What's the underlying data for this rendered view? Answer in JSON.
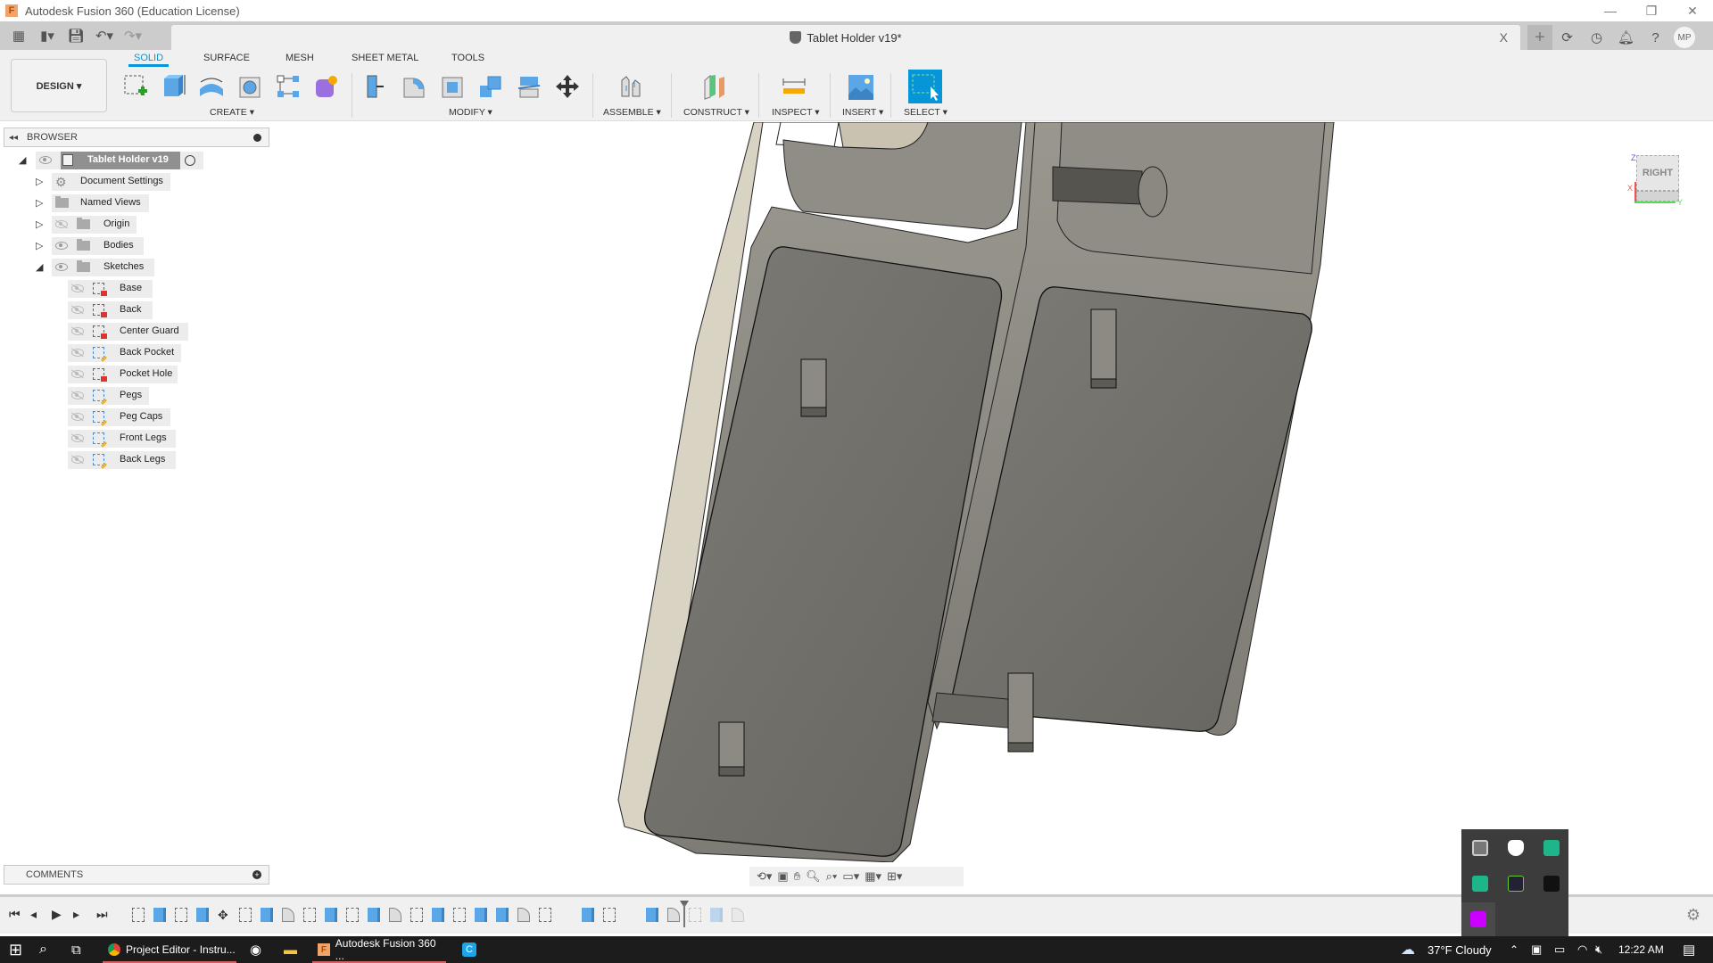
{
  "window": {
    "title": "Autodesk Fusion 360 (Education License)",
    "controls": [
      "minimize",
      "restore",
      "close"
    ]
  },
  "quick_access": {
    "icons": [
      "app-grid-icon",
      "file-icon",
      "save-icon",
      "undo-icon",
      "redo-icon"
    ]
  },
  "document_tab": {
    "name": "Tablet Holder v19*",
    "close_label": "X"
  },
  "header_right": {
    "new_tab_label": "+",
    "icons": [
      "extensions-icon",
      "job-status-icon",
      "notifications-icon",
      "help-icon"
    ],
    "user_initials": "MP"
  },
  "ribbon": {
    "workspace_label": "DESIGN ▾",
    "tabs": [
      {
        "label": "SOLID",
        "active": true
      },
      {
        "label": "SURFACE",
        "active": false
      },
      {
        "label": "MESH",
        "active": false
      },
      {
        "label": "SHEET METAL",
        "active": false
      },
      {
        "label": "TOOLS",
        "active": false
      }
    ],
    "groups": {
      "create": "CREATE ▾",
      "modify": "MODIFY ▾",
      "assemble": "ASSEMBLE ▾",
      "construct": "CONSTRUCT ▾",
      "inspect": "INSPECT ▾",
      "insert": "INSERT ▾",
      "select": "SELECT ▾"
    }
  },
  "browser": {
    "header": "BROWSER",
    "root": "Tablet Holder v19",
    "nodes": [
      {
        "label": "Document Settings"
      },
      {
        "label": "Named Views"
      },
      {
        "label": "Origin"
      },
      {
        "label": "Bodies"
      },
      {
        "label": "Sketches"
      }
    ],
    "sketches": [
      {
        "label": "Base",
        "state": "locked"
      },
      {
        "label": "Back",
        "state": "locked"
      },
      {
        "label": "Center Guard",
        "state": "locked"
      },
      {
        "label": "Back Pocket",
        "state": "editable"
      },
      {
        "label": "Pocket Hole",
        "state": "locked"
      },
      {
        "label": "Pegs",
        "state": "editable"
      },
      {
        "label": "Peg Caps",
        "state": "editable"
      },
      {
        "label": "Front Legs",
        "state": "editable"
      },
      {
        "label": "Back Legs",
        "state": "editable"
      }
    ]
  },
  "viewcube": {
    "face": "RIGHT",
    "axes": [
      "X",
      "Y",
      "Z"
    ]
  },
  "comments": {
    "header": "COMMENTS"
  },
  "nav_toolbar": {
    "icons": [
      "orbit-icon",
      "look-at-icon",
      "pan-icon",
      "zoom-icon",
      "fit-icon",
      "display-settings-icon",
      "grid-icon",
      "viewports-icon"
    ]
  },
  "timeline": {
    "controls": [
      "first",
      "previous",
      "play",
      "next",
      "last"
    ],
    "features": [
      "sketch",
      "extrude",
      "sketch",
      "extrude",
      "move",
      "sketch",
      "extrude",
      "fillet",
      "sketch",
      "extrude",
      "sketch",
      "extrude",
      "fillet",
      "sketch",
      "extrude",
      "sketch",
      "extrude",
      "extrude",
      "fillet",
      "sketch",
      "revolve",
      "extrude",
      "sketch",
      "revolve",
      "extrude",
      "fillet",
      "sketch",
      "extrude",
      "fillet"
    ],
    "marker_after_index": 25
  },
  "taskbar": {
    "items": [
      {
        "label": "Project Editor - Instru...",
        "app": "chrome",
        "active": true
      },
      {
        "label": "",
        "app": "steam",
        "active": false
      },
      {
        "label": "",
        "app": "file-explorer",
        "active": false
      },
      {
        "label": "Autodesk Fusion 360 ...",
        "app": "fusion",
        "active": true
      },
      {
        "label": "",
        "app": "c-app",
        "active": false
      }
    ],
    "weather": "37°F  Cloudy",
    "time": "12:22 AM"
  },
  "colors": {
    "accent": "#0696d7",
    "model_body": "#6f6e69",
    "model_light": "#8d8b85",
    "model_edge": "#1a1a1a",
    "model_side": "#d9d3c4"
  }
}
